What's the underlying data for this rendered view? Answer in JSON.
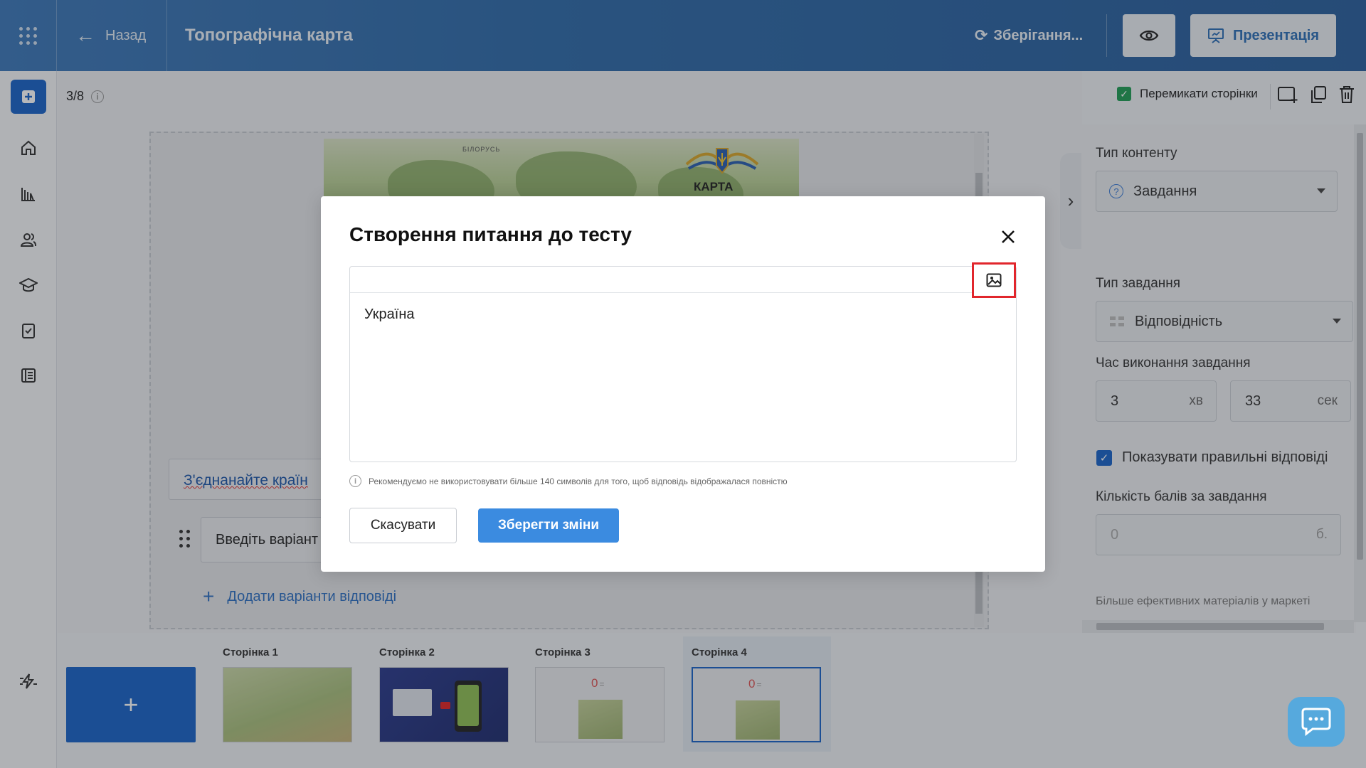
{
  "header": {
    "back_label": "Назад",
    "title": "Топографічна карта",
    "saving_label": "Зберігання...",
    "present_label": "Презентація"
  },
  "editor_bar": {
    "page_counter": "3/8",
    "toggle_pages_label": "Перемикати сторінки"
  },
  "slide": {
    "map_belarus": "БІЛОРУСЬ",
    "map_title": "КАРТА",
    "question_placeholder": "З'єднанайте країн",
    "option_placeholder": "Введіть варіант",
    "add_options_label": "Додати варіанти відповіді"
  },
  "right_panel": {
    "content_type_label": "Тип контенту",
    "content_type_value": "Завдання",
    "task_type_label": "Тип завдання",
    "task_type_value": "Відповідність",
    "time_label": "Час виконання завдання",
    "minutes_value": "3",
    "minutes_unit": "хв",
    "seconds_value": "33",
    "seconds_unit": "сек",
    "show_answers_label": "Показувати правильні відповіді",
    "points_label": "Кількість балів за завдання",
    "points_value": "0",
    "points_unit": "б.",
    "market_label": "Більше ефективних матеріалів у маркеті"
  },
  "pages": [
    {
      "label": "Сторінка 1"
    },
    {
      "label": "Сторінка 2"
    },
    {
      "label": "Сторінка 3"
    },
    {
      "label": "Сторінка 4"
    }
  ],
  "add_page_label": "+",
  "modal": {
    "title": "Створення питання до тесту",
    "editor_text": "Україна",
    "hint": "Рекомендуємо не використовувати більше 140 символів для того, щоб відповідь відображалася повністю",
    "cancel_label": "Скасувати",
    "save_label": "Зберегти зміни"
  },
  "colors": {
    "accent": "#1a64c7",
    "save_button": "#3b8be0",
    "highlight": "#e1262c",
    "header": "#2f6aa8"
  }
}
